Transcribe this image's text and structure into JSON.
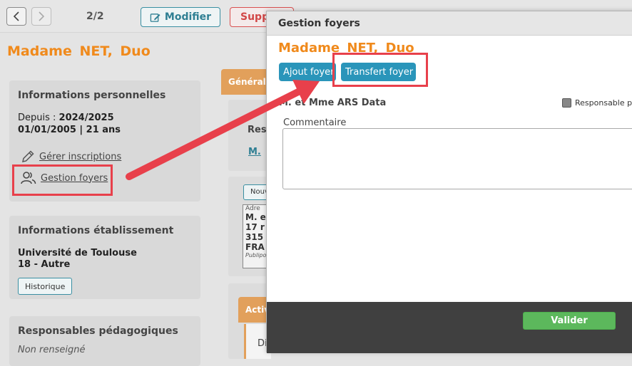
{
  "header": {
    "counter": "2/2",
    "modify_label": "Modifier",
    "delete_label": "Supprimer"
  },
  "person": {
    "name": "Madame  NET, Duo"
  },
  "info_perso": {
    "title": "Informations personnelles",
    "since_label": "Depuis : ",
    "since_value": "2024/2025",
    "birth": "01/01/2005 | 21 ans",
    "manage_inscriptions": "Gérer inscriptions",
    "gestion_foyers": "Gestion foyers"
  },
  "info_etab": {
    "title": "Informations établissement",
    "university": "Université de Toulouse",
    "code": "18 - Autre",
    "history_button": "Historique"
  },
  "resp_peda": {
    "title": "Responsables pédagogiques",
    "value": "Non renseigné"
  },
  "background_tabs": {
    "general": "Généralités",
    "activities": "Activités"
  },
  "background_panel": {
    "resp": "Res",
    "m_link": "M.",
    "nouv": "Nouv",
    "addr_label": "Adre",
    "addr_lines": [
      "M. e",
      "17 r",
      "315",
      "FRA"
    ],
    "addr_footer": "Publipo",
    "di": "Di"
  },
  "modal": {
    "title": "Gestion foyers",
    "name": "Madame  NET, Duo",
    "add_button": "Ajout foyer",
    "transfer_button": "Transfert foyer",
    "foyer_name": "M. et Mme ARS Data",
    "responsible_label": "Responsable pr",
    "comment_label": "Commentaire",
    "comment_value": "",
    "validate_button": "Valider"
  },
  "colors": {
    "accent_orange": "#f08a1c",
    "teal_button": "#2a95ba",
    "validate_green": "#5cb85c",
    "annotation_red": "#e8404b"
  }
}
